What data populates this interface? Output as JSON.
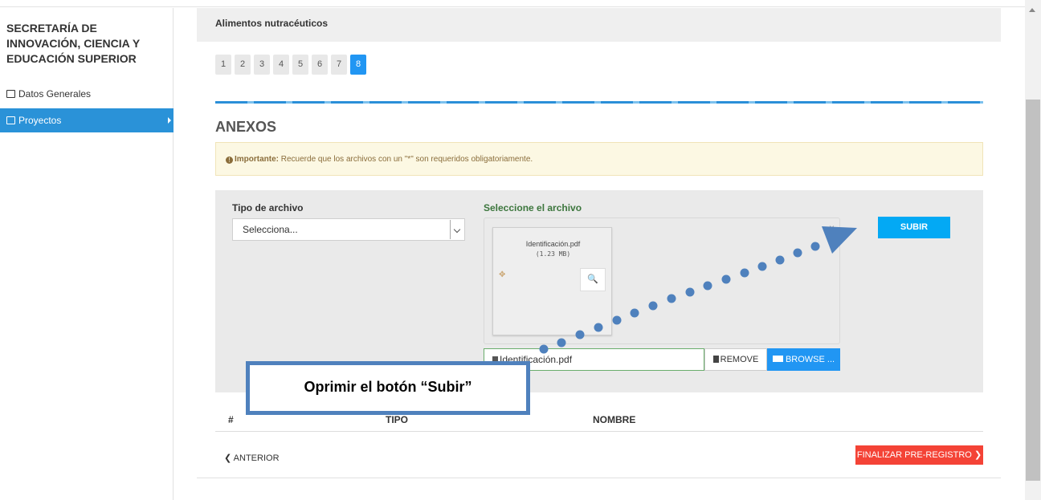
{
  "sidebar": {
    "title": "SECRETARÍA DE INNOVACIÓN, CIENCIA Y EDUCACIÓN SUPERIOR",
    "items": [
      {
        "label": "Datos Generales",
        "icon": "square-icon"
      },
      {
        "label": "Proyectos",
        "icon": "folder-open-icon",
        "active": true
      }
    ]
  },
  "header": {
    "title": "Alimentos nutracéuticos"
  },
  "pager": [
    "1",
    "2",
    "3",
    "4",
    "5",
    "6",
    "7",
    "8"
  ],
  "pager_active": "8",
  "section": {
    "title": "ANEXOS"
  },
  "alert": {
    "strong": "Importante:",
    "text": " Recuerde que los archivos con un \"*\" son requeridos obligatoriamente."
  },
  "form": {
    "tipo_label": "Tipo de archivo",
    "tipo_value": "Selecciona...",
    "archivo_label": "Seleccione el archivo",
    "file_name": "Identificación.pdf",
    "file_size": "(1.23 MB)",
    "input_value": "Identificación.pdf",
    "remove_label": "REMOVE",
    "browse_label": "BROWSE ...",
    "subir_label": "SUBIR"
  },
  "table": {
    "headers": [
      "#",
      "TIPO",
      "NOMBRE"
    ]
  },
  "nav": {
    "anterior": "ANTERIOR",
    "finalizar": "FINALIZAR PRE-REGISTRO"
  },
  "annotation": {
    "text": "Oprimir el botón “Subir”",
    "color": "#4f81bd"
  },
  "colors": {
    "primary": "#2196f3",
    "danger": "#f44336",
    "subir": "#03a9f4",
    "sidebar_active": "#2a92d8",
    "alert_bg": "#fcf8e3"
  }
}
